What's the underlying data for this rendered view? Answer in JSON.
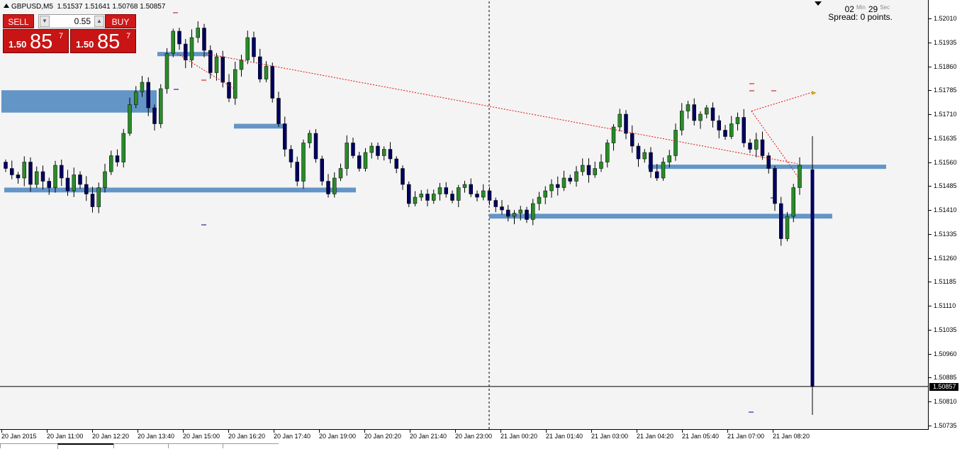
{
  "chart_header": {
    "symbol_timeframe": "GBPUSD,M5",
    "ohlc": "1.51537 1.51641 1.50768 1.50857"
  },
  "one_click_trading": {
    "sell_label": "SELL",
    "buy_label": "BUY",
    "lot_value": "0.55",
    "sell_price_small": "1.50",
    "sell_price_big": "85",
    "sell_price_sup": "7",
    "buy_price_small": "1.50",
    "buy_price_big": "85",
    "buy_price_sup": "7"
  },
  "timer": {
    "minutes": "02",
    "min_label": "Min",
    "seconds": "29",
    "sec_label": "Sec",
    "spread_text": "Spread: 0 points."
  },
  "colors": {
    "bull_candle": "#2a8a2a",
    "bear_candle": "#000060",
    "sr_zone": "#5b8fc4",
    "trendline": "#e01010",
    "background": "#f4f4f4"
  },
  "chart_data": {
    "type": "candlestick",
    "symbol": "GBPUSD",
    "timeframe": "M5",
    "ylim": [
      1.50735,
      1.52035
    ],
    "y_ticks": [
      "1.52010",
      "1.51935",
      "1.51860",
      "1.51785",
      "1.51710",
      "1.51635",
      "1.51560",
      "1.51485",
      "1.51410",
      "1.51335",
      "1.51260",
      "1.51185",
      "1.51110",
      "1.51035",
      "1.50960",
      "1.50885",
      "1.50810",
      "1.50735"
    ],
    "current_price": "1.50857",
    "x_labels": [
      "20 Jan 2015",
      "20 Jan 11:00",
      "20 Jan 12:20",
      "20 Jan 13:40",
      "20 Jan 15:00",
      "20 Jan 16:20",
      "20 Jan 17:40",
      "20 Jan 19:00",
      "20 Jan 20:20",
      "20 Jan 21:40",
      "20 Jan 23:00",
      "21 Jan 00:20",
      "21 Jan 01:40",
      "21 Jan 03:00",
      "21 Jan 04:20",
      "21 Jan 05:40",
      "21 Jan 07:00",
      "21 Jan 08:20"
    ],
    "last_candle": {
      "open": 1.51537,
      "high": 1.51641,
      "low": 1.50768,
      "close": 1.50857
    },
    "sr_zones": [
      {
        "label": "zone-upper-left",
        "top": 1.51785,
        "bottom": 1.51715
      },
      {
        "label": "zone-top",
        "top": 1.51905,
        "bottom": 1.51892
      },
      {
        "label": "zone-mid",
        "top": 1.5168,
        "bottom": 1.51665
      },
      {
        "label": "zone-left-support",
        "top": 1.5148,
        "bottom": 1.51465
      },
      {
        "label": "zone-right-resistance",
        "top": 1.51552,
        "bottom": 1.5154
      },
      {
        "label": "zone-right-support",
        "top": 1.51398,
        "bottom": 1.51383
      }
    ],
    "path_close": [
      1.5154,
      1.5152,
      1.5151,
      1.5156,
      1.5149,
      1.5153,
      1.515,
      1.5148,
      1.5155,
      1.5151,
      1.5147,
      1.5152,
      1.5149,
      1.5146,
      1.5142,
      1.5148,
      1.5153,
      1.5158,
      1.5156,
      1.5165,
      1.5174,
      1.5178,
      1.5181,
      1.5173,
      1.5168,
      1.5179,
      1.519,
      1.5197,
      1.5193,
      1.5188,
      1.5195,
      1.5198,
      1.5191,
      1.5184,
      1.5189,
      1.5181,
      1.5176,
      1.5185,
      1.5188,
      1.5195,
      1.5189,
      1.5182,
      1.5186,
      1.5176,
      1.5168,
      1.516,
      1.5156,
      1.515,
      1.5162,
      1.5165,
      1.5157,
      1.515,
      1.5146,
      1.5151,
      1.5154,
      1.5162,
      1.5158,
      1.5154,
      1.5159,
      1.5161,
      1.5158,
      1.516,
      1.5157,
      1.5154,
      1.5149,
      1.5143,
      1.5145,
      1.5146,
      1.5144,
      1.5146,
      1.5148,
      1.5146,
      1.5144,
      1.5148,
      1.5149,
      1.5146,
      1.5145,
      1.5147,
      1.5144,
      1.5142,
      1.5141,
      1.5139,
      1.514,
      1.5141,
      1.5138,
      1.5143,
      1.5145,
      1.5147,
      1.5149,
      1.5148,
      1.5151,
      1.515,
      1.5153,
      1.5155,
      1.5152,
      1.5154,
      1.5156,
      1.5162,
      1.5167,
      1.5171,
      1.5165,
      1.5161,
      1.5157,
      1.5159,
      1.5153,
      1.5151,
      1.5156,
      1.5158,
      1.5166,
      1.5172,
      1.5174,
      1.5169,
      1.5171,
      1.5173,
      1.5169,
      1.5166,
      1.5164,
      1.5168,
      1.517,
      1.5162,
      1.516,
      1.5163,
      1.5158,
      1.5154,
      1.5143,
      1.5132,
      1.5139,
      1.5148,
      1.5155
    ]
  },
  "tabs": [
    "tab-1",
    "tab-2",
    "tab-3",
    "tab-4",
    "tab-5"
  ]
}
